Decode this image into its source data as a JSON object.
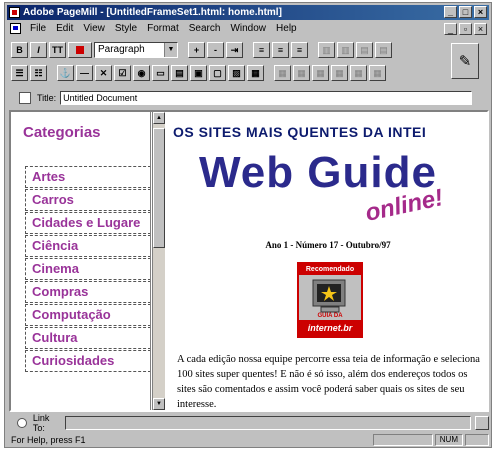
{
  "window": {
    "title": "Adobe PageMill - [UntitledFrameSet1.html: home.html]",
    "controls": [
      "_",
      "□",
      "×"
    ]
  },
  "menubar": {
    "items": [
      "File",
      "Edit",
      "View",
      "Style",
      "Format",
      "Search",
      "Window",
      "Help"
    ],
    "controls": [
      "_",
      "▫",
      "×"
    ]
  },
  "toolbar": {
    "bold": "B",
    "italic": "I",
    "teletype": "TT",
    "paragraph_select": "Paragraph",
    "font_up": "+",
    "font_down": "-"
  },
  "title_field": {
    "label": "Title:",
    "value": "Untitled Document"
  },
  "left_frame": {
    "heading": "Categorias",
    "categories": [
      "Artes",
      "Carros",
      "Cidades e Lugare",
      "Ciência",
      "Cinema",
      "Compras",
      "Computação",
      "Cultura",
      "Curiosidades"
    ]
  },
  "main_frame": {
    "headline": "OS SITES MAIS QUENTES DA INTEI",
    "logo_main": "Web Guide",
    "logo_sub": "online!",
    "issue_line": "Ano 1 - Número 17 - Outubro/97",
    "seal_top": "Recomendado",
    "seal_small": "GUIA DA",
    "seal_bottom": "internet.br",
    "body": "A cada edição nossa equipe percorre essa teia de informação e seleciona 100 sites super quentes! E não é só isso, além dos endereços todos os sites são comentados e assim você poderá saber quais os sites de seu interesse."
  },
  "link_bar": {
    "label": "Link To:"
  },
  "status_bar": {
    "message": "For Help, press F1",
    "num": "NUM"
  },
  "colors": {
    "category": "#993399",
    "headline": "#0d1b6e",
    "logo": "#2b2a8c",
    "titlebar": "#0a246a"
  }
}
